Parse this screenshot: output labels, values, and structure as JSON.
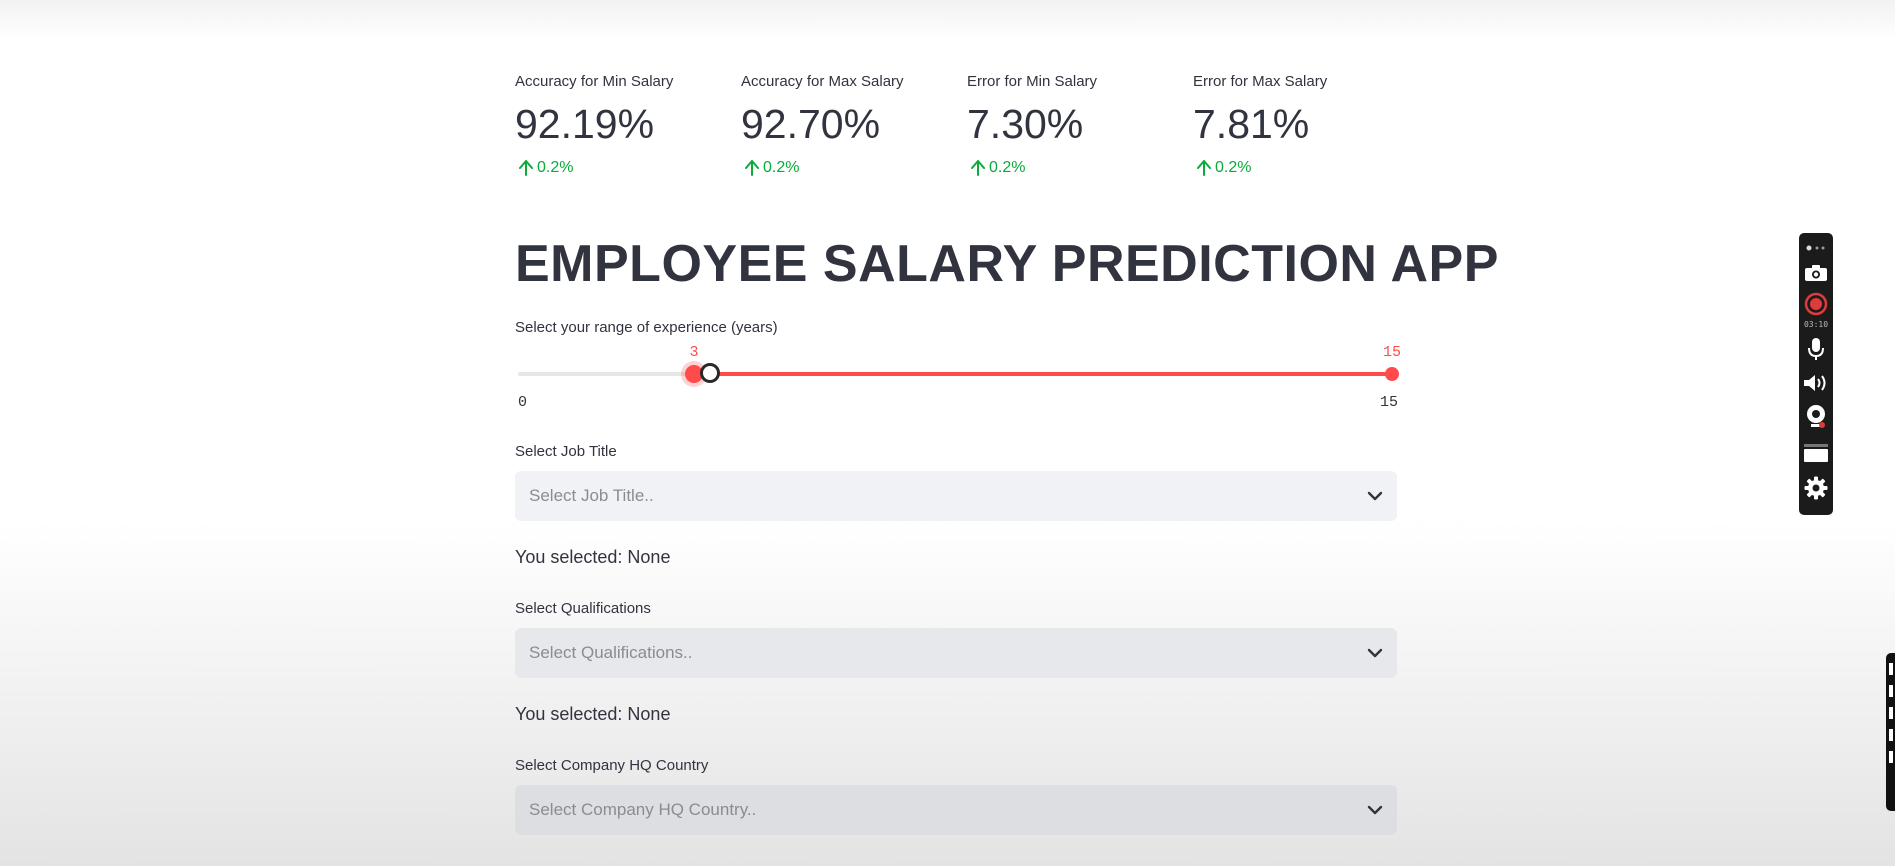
{
  "metrics": [
    {
      "label": "Accuracy for Min Salary",
      "value": "92.19%",
      "delta": "0.2%",
      "delta_direction": "up"
    },
    {
      "label": "Accuracy for Max Salary",
      "value": "92.70%",
      "delta": "0.2%",
      "delta_direction": "up"
    },
    {
      "label": "Error for Min Salary",
      "value": "7.30%",
      "delta": "0.2%",
      "delta_direction": "up"
    },
    {
      "label": "Error for Max Salary",
      "value": "7.81%",
      "delta": "0.2%",
      "delta_direction": "up"
    }
  ],
  "title": "EMPLOYEE SALARY PREDICTION APP",
  "experience_slider": {
    "label": "Select your range of experience (years)",
    "min": 0,
    "max": 15,
    "low_value": 3,
    "high_value": 15,
    "min_label": "0",
    "max_label": "15",
    "low_label": "3",
    "high_label": "15"
  },
  "job_title": {
    "label": "Select Job Title",
    "placeholder": "Select Job Title..",
    "selected_text": "You selected: None"
  },
  "qualifications": {
    "label": "Select Qualifications",
    "placeholder": "Select Qualifications..",
    "selected_text": "You selected: None"
  },
  "company_country": {
    "label": "Select Company HQ Country",
    "placeholder": "Select Company HQ Country.."
  },
  "recorder_toolbar": {
    "timer": "03:10",
    "icons": [
      "screenshot-icon",
      "record-icon",
      "microphone-icon",
      "speaker-icon",
      "webcam-icon",
      "window-icon",
      "settings-icon"
    ]
  },
  "colors": {
    "accent": "#ff4b4b",
    "delta_positive": "#09ab3b",
    "text": "#31333f",
    "select_bg": "#f0f2f6"
  }
}
